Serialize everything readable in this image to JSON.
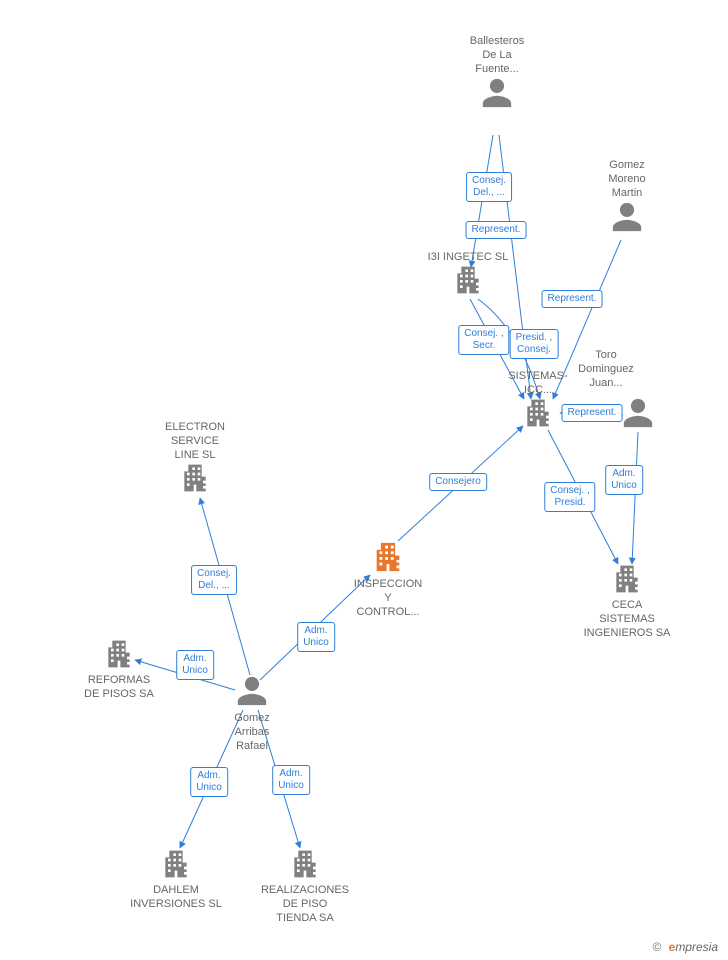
{
  "colors": {
    "link": "#2f7ed8",
    "node": "#808080",
    "highlight": "#e8762c",
    "text": "#666666"
  },
  "nodes": {
    "ballesteros": {
      "type": "person",
      "label": "Ballesteros\nDe La\nFuente..."
    },
    "gomez_moreno": {
      "type": "person",
      "label": "Gomez\nMoreno\nMartin"
    },
    "i3i": {
      "type": "company",
      "label": "I3I INGETEC SL"
    },
    "toro": {
      "type": "person",
      "label": "Toro\nDominguez\nJuan..."
    },
    "sistemas_icc": {
      "type": "company",
      "label": "SISTEMAS-\nICC..."
    },
    "electron": {
      "type": "company",
      "label": "ELECTRON\nSERVICE\nLINE SL"
    },
    "inspeccion": {
      "type": "company",
      "label": "INSPECCION\nY\nCONTROL...",
      "highlighted": true
    },
    "ceca": {
      "type": "company",
      "label": "CECA\nSISTEMAS\nINGENIEROS SA"
    },
    "reformas": {
      "type": "company",
      "label": "REFORMAS\nDE PISOS SA"
    },
    "gomez_arribas": {
      "type": "person",
      "label": "Gomez\nArribas\nRafael"
    },
    "dahlem": {
      "type": "company",
      "label": "DAHLEM\nINVERSIONES SL"
    },
    "realizaciones": {
      "type": "company",
      "label": "REALIZACIONES\nDE PISO\nTIENDA SA"
    }
  },
  "edges": [
    {
      "from": "ballesteros",
      "to": "i3i",
      "label": "Consej.\nDel., ..."
    },
    {
      "from": "ballesteros",
      "to": "sistemas_icc",
      "label": "Represent."
    },
    {
      "from": "gomez_moreno",
      "to": "sistemas_icc",
      "label": "Represent."
    },
    {
      "from": "i3i",
      "to": "sistemas_icc",
      "label": "Consej. ,\nSecr."
    },
    {
      "from": "i3i",
      "to": "sistemas_icc",
      "label": "Presid. ,\nConsej."
    },
    {
      "from": "toro",
      "to": "sistemas_icc",
      "label": "Represent."
    },
    {
      "from": "toro",
      "to": "ceca",
      "label": "Adm.\nUnico"
    },
    {
      "from": "sistemas_icc",
      "to": "ceca",
      "label": "Consej. ,\nPresid."
    },
    {
      "from": "inspeccion",
      "to": "sistemas_icc",
      "label": "Consejero"
    },
    {
      "from": "gomez_arribas",
      "to": "inspeccion",
      "label": "Adm.\nUnico"
    },
    {
      "from": "gomez_arribas",
      "to": "electron",
      "label": "Consej.\nDel., ..."
    },
    {
      "from": "gomez_arribas",
      "to": "reformas",
      "label": "Adm.\nUnico"
    },
    {
      "from": "gomez_arribas",
      "to": "dahlem",
      "label": "Adm.\nUnico"
    },
    {
      "from": "gomez_arribas",
      "to": "realizaciones",
      "label": "Adm.\nUnico"
    }
  ],
  "footer": {
    "copyright": "©",
    "brand_first": "e",
    "brand_rest": "mpresia"
  }
}
